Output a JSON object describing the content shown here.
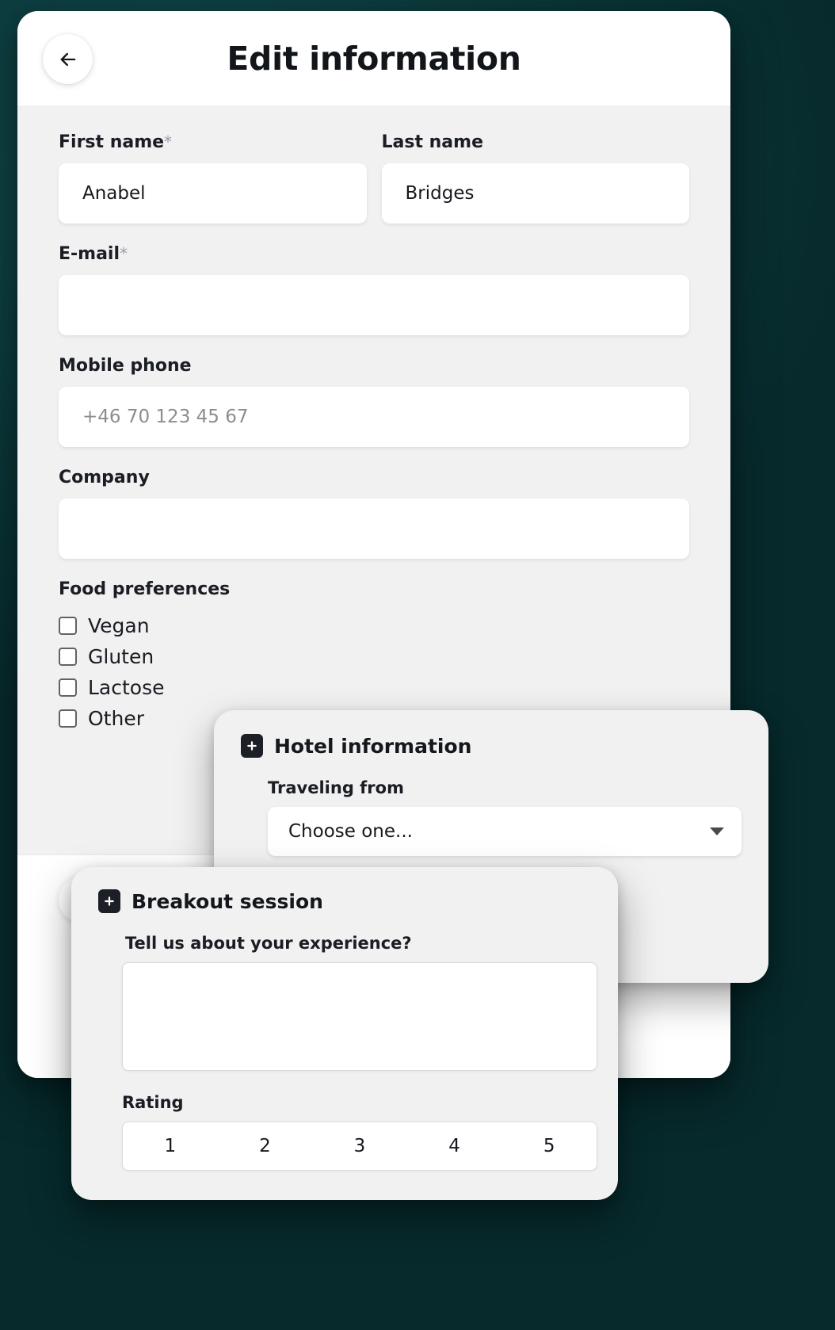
{
  "header": {
    "title": "Edit information",
    "back_icon": "arrow-left-icon"
  },
  "form": {
    "first_name": {
      "label": "First name",
      "required_mark": "*",
      "value": "Anabel",
      "placeholder": ""
    },
    "last_name": {
      "label": "Last name",
      "value": "Bridges",
      "placeholder": ""
    },
    "email": {
      "label": "E-mail",
      "required_mark": "*",
      "value": "",
      "placeholder": ""
    },
    "mobile_phone": {
      "label": "Mobile phone",
      "value": "",
      "placeholder": "+46 70 123 45 67"
    },
    "company": {
      "label": "Company",
      "value": "",
      "placeholder": ""
    },
    "food_preferences": {
      "label": "Food preferences",
      "options": [
        {
          "label": "Vegan",
          "checked": false
        },
        {
          "label": "Gluten",
          "checked": false
        },
        {
          "label": "Lactose",
          "checked": false
        },
        {
          "label": "Other",
          "checked": false
        }
      ]
    }
  },
  "hotel_card": {
    "title": "Hotel information",
    "icon": "plus-square-icon",
    "traveling_from": {
      "label": "Traveling from",
      "selected": "Choose one...",
      "caret_icon": "chevron-down-icon"
    }
  },
  "breakout_card": {
    "title": "Breakout session",
    "icon": "plus-square-icon",
    "experience": {
      "label": "Tell us about your experience?",
      "value": "",
      "placeholder": ""
    },
    "rating": {
      "label": "Rating",
      "values": [
        "1",
        "2",
        "3",
        "4",
        "5"
      ]
    }
  },
  "colors": {
    "background": "#072a2c",
    "card": "#ffffff",
    "form_bg": "#f1f1f1",
    "text": "#15181d",
    "muted": "#8d8d8d"
  }
}
